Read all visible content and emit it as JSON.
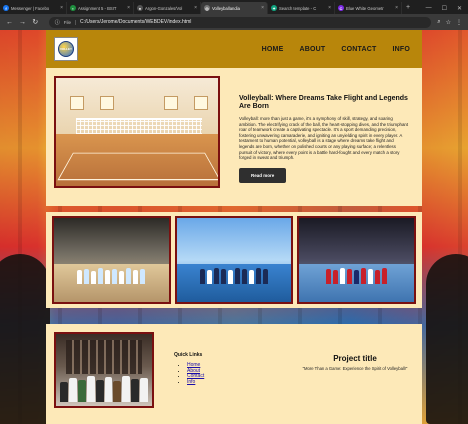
{
  "browser": {
    "tabs": [
      {
        "title": "Messenger | Facebo",
        "icon": "facebook-icon",
        "color": "#1877f2",
        "glyph": "f"
      },
      {
        "title": "Assignment 5 - BSIT",
        "icon": "google-classroom-icon",
        "color": "#1e8e3e",
        "glyph": "▪"
      },
      {
        "title": "Argon-Gonzales/Vol",
        "icon": "github-icon",
        "color": "#555555",
        "glyph": "●"
      },
      {
        "title": "Volleyballandia",
        "icon": "globe-icon",
        "color": "#777777",
        "glyph": "◎"
      },
      {
        "title": "Search template - C",
        "icon": "chatgpt-icon",
        "color": "#10a37f",
        "glyph": "✦"
      },
      {
        "title": "Blue White Geometr",
        "icon": "canva-icon",
        "color": "#7d2ae8",
        "glyph": "C"
      }
    ],
    "active_tab_index": 3,
    "address_label": "File",
    "url": "C:/Users/Jerome/Documents/WEBDEV/index.html"
  },
  "header": {
    "logo_text": "VOLLEY",
    "nav": [
      "HOME",
      "ABOUT",
      "CONTACT",
      "INFO"
    ]
  },
  "hero": {
    "title": "Volleyball: Where Dreams Take Flight and Legends Are Born",
    "body": "Volleyball: more than just a game, it's a symphony of skill, strategy, and soaring ambition. The electrifying crack of the ball, the heart-stopping dives, and the triumphant roar of teamwork create a captivating spectacle. It's a sport demanding precision, fostering unwavering camaraderie, and igniting an unyielding spirit in every player. A testament to human potential, volleyball is a stage where dreams take flight and legends are born, whether on polished courts or any playing surface; a relentless pursuit of victory, where every point is a battle hard-fought and every match a story forged in sweat and triumph.",
    "button": "Read more"
  },
  "footer": {
    "quick_links_title": "Quick Links",
    "quick_links": [
      "Home",
      "About",
      "Contact",
      "Info"
    ],
    "project_title": "Project title",
    "project_subtitle": "\"More Than a Game: Experience the Spirit of Volleyball!\""
  }
}
